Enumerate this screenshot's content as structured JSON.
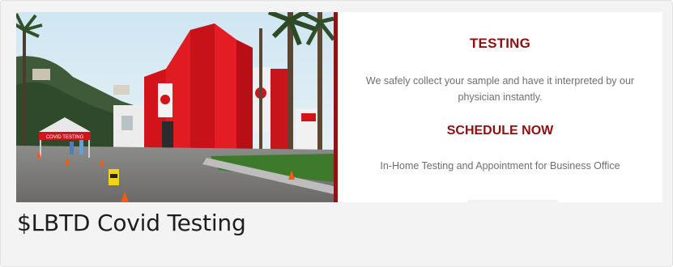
{
  "banner": {
    "photo_alt": "Covid testing site with red building and white tents",
    "title": "TESTING",
    "description": "We safely collect your sample and have it interpreted by our physician instantly.",
    "cta_heading": "SCHEDULE NOW",
    "subtext": "In-Home Testing and Appointment for Business Office",
    "accent_color": "#8a1111",
    "divider_color": "#8e1414",
    "tent_sign": "COVID TESTING"
  },
  "card": {
    "caption": "$LBTD Covid Testing"
  }
}
